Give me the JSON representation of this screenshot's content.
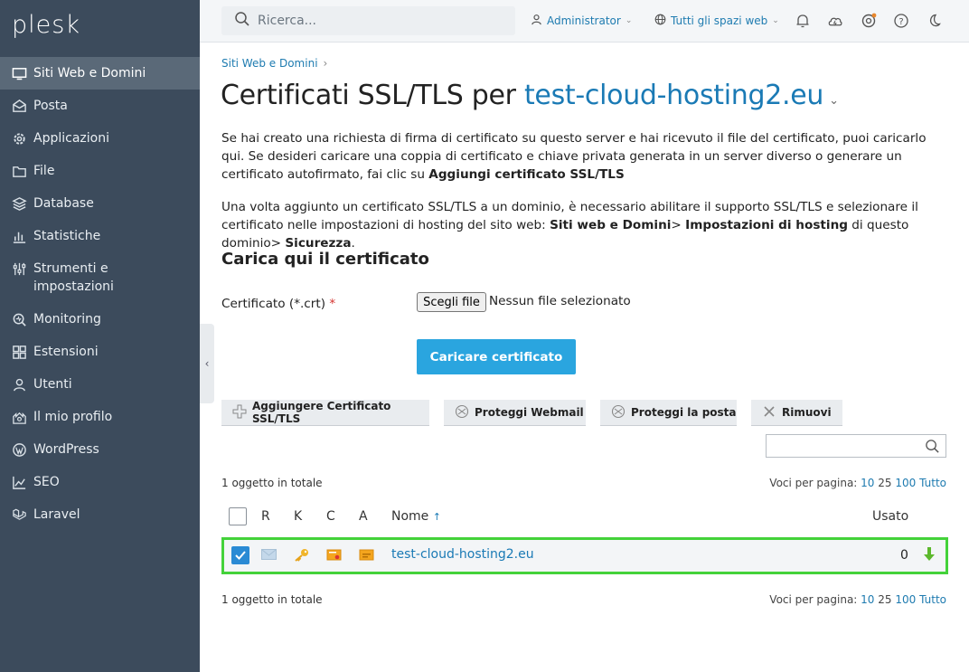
{
  "brand": {
    "logo_text": "plesk"
  },
  "sidebar": {
    "items": [
      {
        "label": "Siti Web e Domini",
        "icon": "monitor-icon",
        "active": true
      },
      {
        "label": "Posta",
        "icon": "mail-icon"
      },
      {
        "label": "Applicazioni",
        "icon": "gear-icon"
      },
      {
        "label": "File",
        "icon": "folder-icon"
      },
      {
        "label": "Database",
        "icon": "database-icon"
      },
      {
        "label": "Statistiche",
        "icon": "bar-chart-icon"
      },
      {
        "label": "Strumenti e impostazioni",
        "icon": "sliders-icon"
      },
      {
        "label": "Monitoring",
        "icon": "monitoring-icon"
      },
      {
        "label": "Estensioni",
        "icon": "extensions-icon"
      },
      {
        "label": "Utenti",
        "icon": "user-icon"
      },
      {
        "label": "Il mio profilo",
        "icon": "profile-icon"
      },
      {
        "label": "WordPress",
        "icon": "wordpress-icon"
      },
      {
        "label": "SEO",
        "icon": "seo-icon"
      },
      {
        "label": "Laravel",
        "icon": "laravel-icon"
      }
    ]
  },
  "topbar": {
    "search_placeholder": "Ricerca...",
    "user_label": "Administrator",
    "subscriptions_label": "Tutti gli spazi web"
  },
  "breadcrumb": {
    "item": "Siti Web e Domini"
  },
  "page": {
    "title_prefix": "Certificati SSL/TLS per",
    "title_domain": "test-cloud-hosting2.eu"
  },
  "intro": {
    "p1_text": "Se hai creato una richiesta di firma di certificato su questo server e hai ricevuto il file del certificato, puoi caricarlo qui. Se desideri caricare una coppia di certificato e chiave privata generata in un server diverso o generare un certificato autofirmato, fai clic su",
    "p1_bold": "Aggiungi certificato SSL/TLS",
    "p2_a": "Una volta aggiunto un certificato SSL/TLS a un dominio, è necessario abilitare il supporto SSL/TLS e selezionare il certificato nelle impostazioni di hosting del sito web:",
    "p2_b1": "Siti web e Domini",
    "p2_c": "> ",
    "p2_b2": "Impostazioni di hosting",
    "p2_d": " di questo dominio> ",
    "p2_b3": "Sicurezza",
    "p2_e": "."
  },
  "upload": {
    "section_title": "Carica qui il certificato",
    "field_label": "Certificato (*.crt)",
    "required_mark": "*",
    "file_button": "Scegli file",
    "file_status": "Nessun file selezionato",
    "submit_label": "Caricare certificato"
  },
  "toolbar": {
    "add_label": "Aggiungere Certificato SSL/TLS",
    "webmail_label": "Proteggi Webmail",
    "mail_label": "Proteggi la posta",
    "remove_label": "Rimuovi"
  },
  "list": {
    "total_text": "1 oggetto in totale",
    "per_page_label": "Voci per pagina:",
    "per_page_options": [
      "10",
      "25",
      "100",
      "Tutto"
    ],
    "columns": {
      "r": "R",
      "k": "K",
      "c": "C",
      "a": "A",
      "name": "Nome",
      "sort_arrow": "↑",
      "used": "Usato"
    },
    "rows": [
      {
        "name": "test-cloud-hosting2.eu",
        "used": "0",
        "checked": true
      }
    ]
  }
}
